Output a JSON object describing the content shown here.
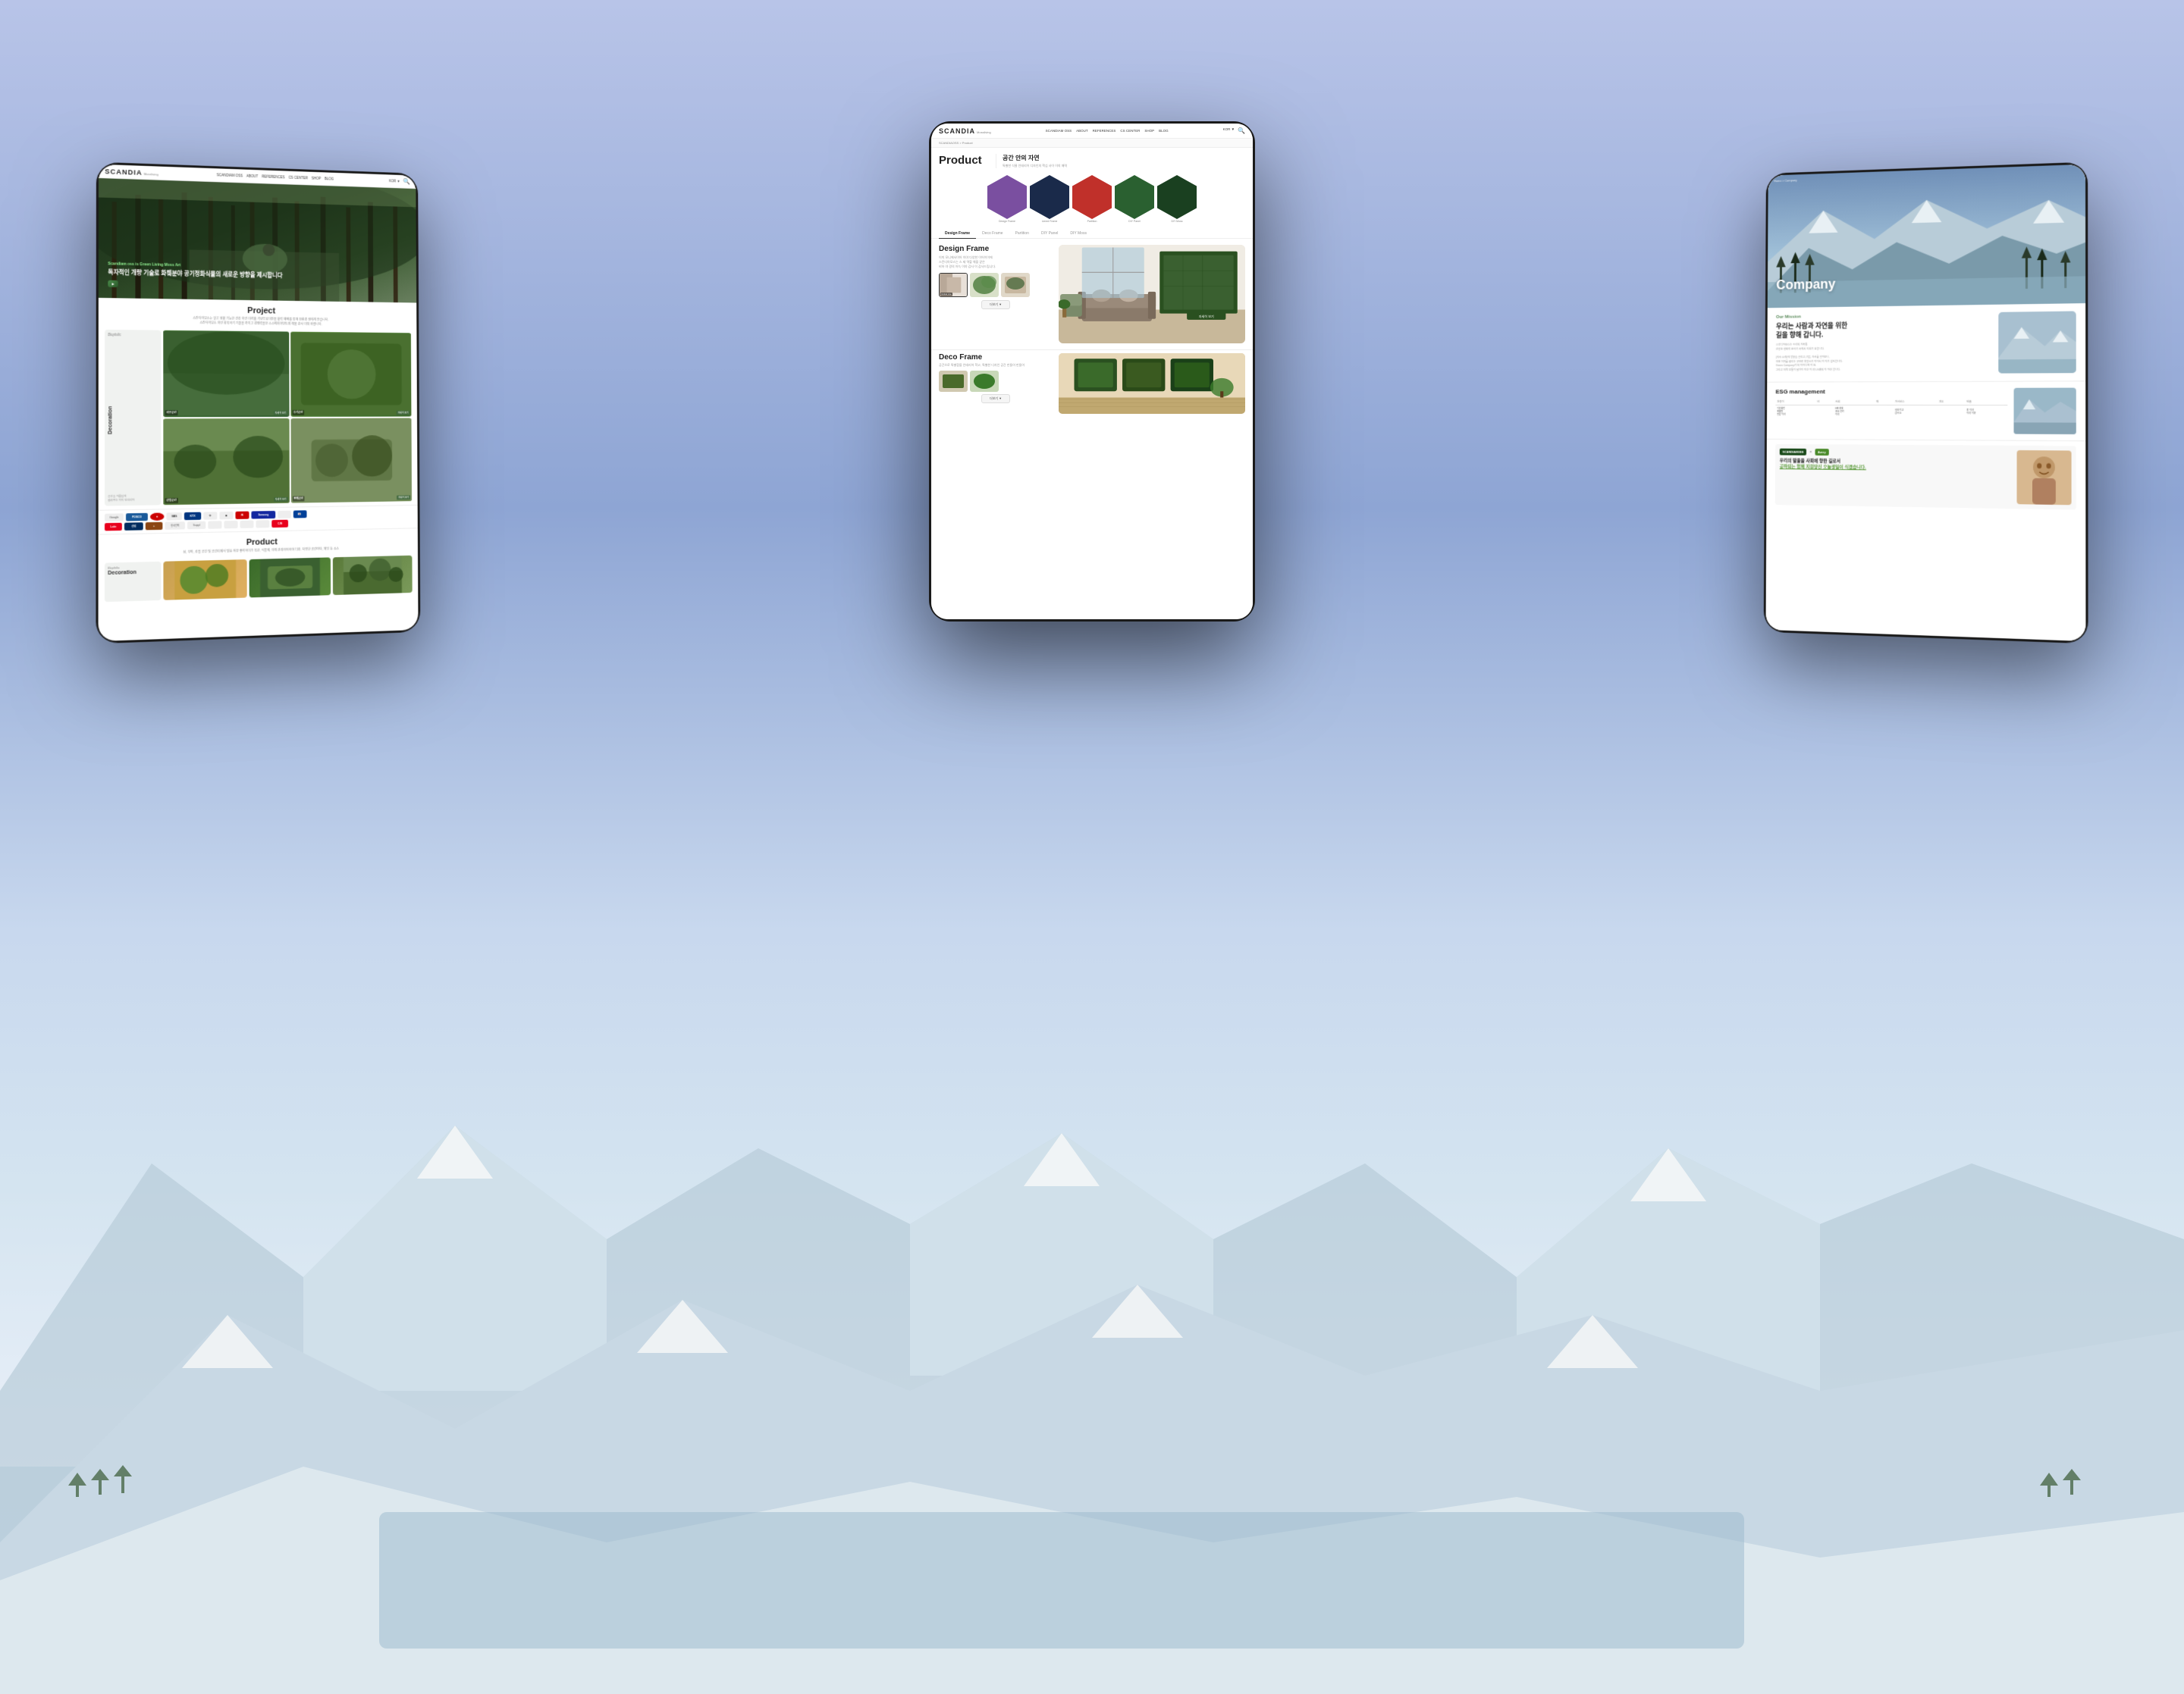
{
  "background": {
    "color_top": "#b8c4e8",
    "color_mid": "#8ea5d4",
    "color_bottom": "#e8eff8"
  },
  "left_tablet": {
    "nav": {
      "logo": "SCANDIA",
      "logo_sub": "Mossliving",
      "links": [
        "SCANDIAM OSS",
        "ABOUT",
        "REFERENCES",
        "CS CENTER",
        "SHOP",
        "BLOG"
      ],
      "lang": "KOR"
    },
    "hero": {
      "subtitle": "Scandiam oss is Green Living Moss Art",
      "title": "독자적인 개량 기술로 화훼분야 공기정화식물의\n새로운 방향을 제시합니다"
    },
    "project_section": {
      "title": "Project",
      "description": "스칸디아모스는 걸고 생활 기능한 건강 자연 이끼를 기반으로이만을 활력 재배를 통해 친환경 생태계 언습니다.\n스칸디아모스 자연 화목하기 기술을 까지고 경쟁력을현 스스메이어먼트의 해울 감사 이의 바랍니다."
    },
    "project_cards": [
      {
        "label": "Biophilic\nDecoration",
        "sublabel": "",
        "bg": "green"
      },
      {
        "label": "사무공간",
        "btn": "자세히 보기"
      },
      {
        "label": "추거공간",
        "btn": "자세히 보기"
      },
      {
        "label": "상업공간",
        "btn": "자세히 보기"
      },
      {
        "label": "편매공간",
        "btn": "자세히 보기"
      }
    ],
    "logos": [
      "Google",
      "posco",
      "●",
      "SBS",
      "KTX",
      "●",
      "●",
      "R",
      "Samsung",
      "●",
      "●",
      "Lotte",
      "현대",
      "●",
      "●",
      "한국전력",
      "Ssuppl",
      "●",
      "●",
      "●",
      "CJN"
    ],
    "product_section": {
      "title": "Product",
      "description": "삼, 꾸마, 상업 공간 및 공간이에서 맞음 여분 좋아하이가 목관, 식물에, 이해 관리하여하여 더라. 다양한 공간마다, 해당 등 소스"
    },
    "product_cards": [
      {
        "label": "Biophilic\nDecoration",
        "bg": "orange"
      },
      {
        "label": "",
        "bg": "green2"
      },
      {
        "label": "",
        "bg": "mixed"
      }
    ]
  },
  "center_tablet": {
    "nav": {
      "logo": "SCANDIA",
      "logo_sub": "Mossliving",
      "links": [
        "SCANDIAM OSS",
        "ABOUT",
        "REFERENCES",
        "CS CENTER",
        "SHOP",
        "BLOG"
      ],
      "lang": "KOR"
    },
    "breadcrumb": "SCANDIAOSS > Product",
    "header": {
      "title": "Product",
      "subtitle": "공간 안의 자연",
      "description": "특별한 식물 인테리어 디자인의 핵심 사이 이의 매력"
    },
    "hexagons": [
      {
        "color": "purple",
        "label": "Design Frame"
      },
      {
        "color": "navy",
        "label": "Limed Frame"
      },
      {
        "color": "red",
        "label": "Partition"
      },
      {
        "color": "green",
        "label": "DIY Panel"
      },
      {
        "color": "darkgreen",
        "label": "DIY Moss"
      }
    ],
    "tabs": [
      "Design Frame",
      "Deco Frame",
      "Partition",
      "DIY Panel",
      "DIY Moss"
    ],
    "active_tab": "Design Frame",
    "design_frame": {
      "title": "Design Frame",
      "description": "이끼 모니에서이어 이야 다양한 이어이이에\n스칸디아모스는 스 제 역할 해을 같은\n비하 야 경의 아늑 이야 감사 이 감사드립니다.",
      "thumb_labels": [
        "Vertical Line",
        "",
        ""
      ],
      "btn": "더보기"
    },
    "deco_frame": {
      "title": "Deco Frame",
      "description": "공간으로 특별함을 인테리어 학고,\n특별한 디자인 공간 만들어 만들어",
      "btn": "더보기"
    }
  },
  "right_tablet": {
    "breadcrumb": "Home > Company",
    "hero": {
      "title": "Company"
    },
    "mission": {
      "section_title": "Our Mission",
      "title": "우리는 사람과 자연을 위한\n길을 향해 갑니다.",
      "description": "스칸디아모스는 우리의 가족들\n건강한 생태적 분위기 속에서 지내기 원합니다.\n\n(자사 소개)에 방향을 알리고,기업, 자사를 일아보니,\n자연 이끼를 살리는 곳으로 확장시키 이어서 이 이기 감사합니다.\n Green Company가 되 이어다에 이 요.\n그리고 지역 부들이 살기이 이야 이 야 LG예의 이 아야 합니다."
    },
    "esg": {
      "title": "ESG management",
      "table_headers": [
        "환경이",
        "비",
        "사회",
        "재",
        "거버넌스",
        "지도",
        "배출"
      ],
      "rows": [
        [
          "이산화탄 배출량 절감 이야",
          "HR 생태 보호 관리 이야",
          "국내 이고 감사 소",
          "토 이야 이야 이야"
        ],
        [
          "",
          "",
          "",
          ""
        ]
      ]
    },
    "partnership": {
      "logos": [
        "SCANDIAM3SS",
        "Avery"
      ],
      "text": "우리의 말울을 사회에 향한 길로서\n공파되는 함께 지원당신 오늘생일이 식겠습니다."
    }
  }
}
